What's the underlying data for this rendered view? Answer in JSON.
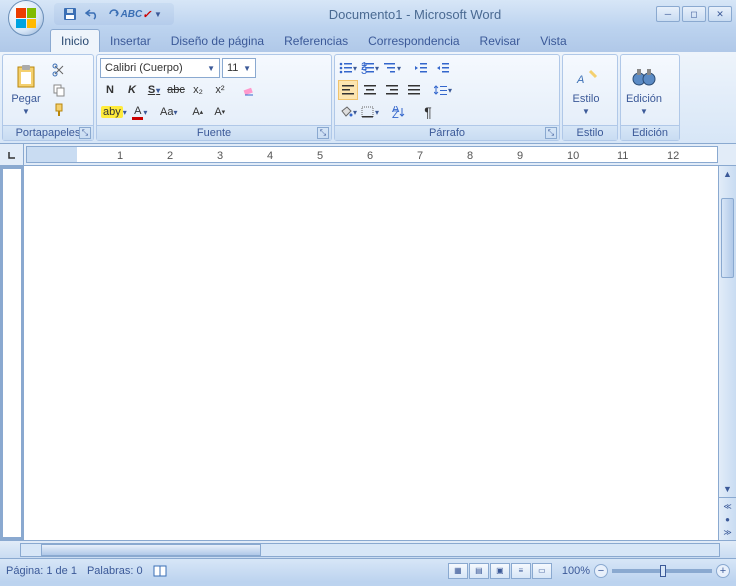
{
  "title": "Documento1 - Microsoft Word",
  "tabs": {
    "inicio": "Inicio",
    "insertar": "Insertar",
    "diseno": "Diseño de página",
    "referencias": "Referencias",
    "correspondencia": "Correspondencia",
    "revisar": "Revisar",
    "vista": "Vista"
  },
  "groups": {
    "portapapeles": "Portapapeles",
    "fuente": "Fuente",
    "parrafo": "Párrafo",
    "estilo": "Estilo",
    "edicion": "Edición"
  },
  "clipboard": {
    "pegar": "Pegar"
  },
  "font": {
    "name": "Calibri (Cuerpo)",
    "size": "11",
    "bold": "N",
    "italic": "K",
    "underline": "S",
    "strike": "abc",
    "sub": "x₂",
    "sup": "x²",
    "highlight": "aby",
    "color": "A",
    "changecase": "Aa",
    "grow": "A",
    "shrink": "A"
  },
  "style": {
    "label": "Estilo"
  },
  "edit": {
    "label": "Edición"
  },
  "ruler": {
    "n1": "1",
    "n2": "2",
    "n3": "3",
    "n4": "4",
    "n5": "5",
    "n6": "6",
    "n7": "7",
    "n8": "8",
    "n9": "9",
    "n10": "10",
    "n11": "11",
    "n12": "12"
  },
  "status": {
    "page": "Página: 1 de 1",
    "words": "Palabras: 0",
    "zoom": "100%"
  }
}
